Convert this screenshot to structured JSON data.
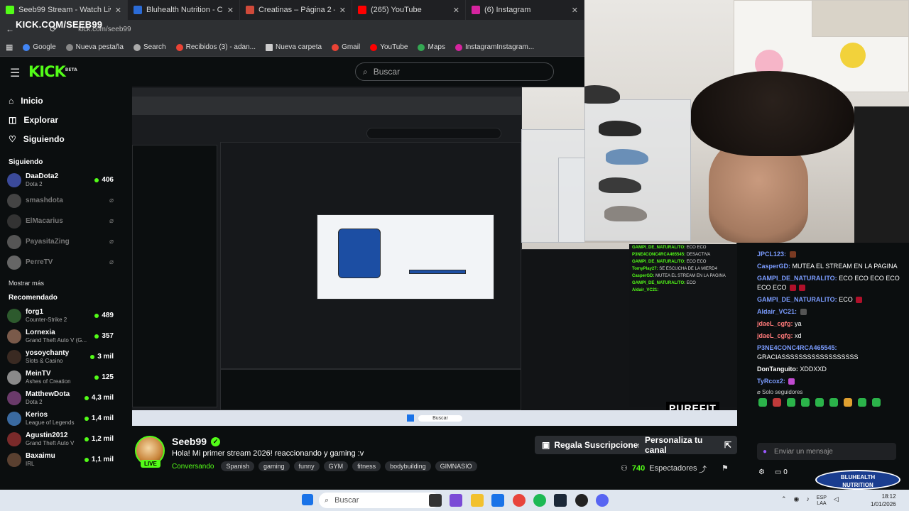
{
  "browser": {
    "tabs": [
      {
        "label": "Seeb99 Stream - Watch Live on",
        "color": "#53fc18",
        "active": true
      },
      {
        "label": "Bluhealth Nutrition - Calidad G",
        "color": "#2b6bd6",
        "active": false
      },
      {
        "label": "Creatinas – Página 2 – XL Nutri",
        "color": "#d04a3a",
        "active": false
      },
      {
        "label": "(265) YouTube",
        "color": "#ff0000",
        "active": false
      },
      {
        "label": "(6) Instagram",
        "color": "#d6249f",
        "active": false
      }
    ],
    "url": "kick.com/seeb99",
    "overlay_title": "KICK.COM/SEEB99",
    "bookmarks": [
      {
        "label": "Google",
        "color": "#4285f4"
      },
      {
        "label": "Nueva pestaña",
        "color": "#888888"
      },
      {
        "label": "Search",
        "color": "#aaaaaa"
      },
      {
        "label": "Recibidos (3) - adan...",
        "color": "#ea4335"
      },
      {
        "label": "Nueva carpeta",
        "color": "#cccccc"
      },
      {
        "label": "Gmail",
        "color": "#ea4335"
      },
      {
        "label": "YouTube",
        "color": "#ff0000"
      },
      {
        "label": "Maps",
        "color": "#34a853"
      },
      {
        "label": "InstagramInstagram...",
        "color": "#d6249f"
      }
    ]
  },
  "header": {
    "logo": "KICK",
    "logo_beta": "BETA",
    "search_placeholder": "Buscar"
  },
  "sidebar": {
    "nav": [
      {
        "label": "Inicio",
        "icon": "home-icon"
      },
      {
        "label": "Explorar",
        "icon": "compass-icon"
      },
      {
        "label": "Siguiendo",
        "icon": "heart-icon"
      }
    ],
    "following_title": "Siguiendo",
    "following": [
      {
        "name": "DaaDota2",
        "game": "Dota 2",
        "viewers": "406",
        "online": true
      },
      {
        "name": "smashdota",
        "game": "",
        "viewers": "",
        "online": false
      },
      {
        "name": "ElMacarius",
        "game": "",
        "viewers": "",
        "online": false
      },
      {
        "name": "PayasitaZing",
        "game": "",
        "viewers": "",
        "online": false
      },
      {
        "name": "PerreTV",
        "game": "",
        "viewers": "",
        "online": false
      }
    ],
    "show_more": "Mostrar más",
    "recommended_title": "Recomendado",
    "recommended": [
      {
        "name": "forg1",
        "game": "Counter-Strike 2",
        "viewers": "489"
      },
      {
        "name": "Lornexia",
        "game": "Grand Theft Auto V (G...",
        "viewers": "357"
      },
      {
        "name": "yosoychanty",
        "game": "Slots & Casino",
        "viewers": "3 mil"
      },
      {
        "name": "MeinTV",
        "game": "Ashes of Creation",
        "viewers": "125"
      },
      {
        "name": "MatthewDota",
        "game": "Dota 2",
        "viewers": "4,3 mil"
      },
      {
        "name": "Kerios",
        "game": "League of Legends",
        "viewers": "1,4 mil"
      },
      {
        "name": "Agustin2012",
        "game": "Grand Theft Auto V",
        "viewers": "1,2 mil"
      },
      {
        "name": "Baxaimu",
        "game": "IRL",
        "viewers": "1,1 mil"
      }
    ]
  },
  "stream": {
    "channel": "Seeb99",
    "live": "LIVE",
    "title": "Hola! Mi primer stream 2026! reaccionando y gaming :v",
    "category": "Conversando",
    "tags": [
      "Spanish",
      "gaming",
      "funny",
      "GYM",
      "fitness",
      "bodybuilding",
      "GIMNASIO"
    ],
    "subscribe_btn": "Regala Suscripciones",
    "customize_btn": "Personaliza tu canal",
    "viewers": "740",
    "viewers_label": "Espectadores"
  },
  "chat": {
    "messages": [
      {
        "user": "JPCL123:",
        "text": "",
        "color": "#7b9cff"
      },
      {
        "user": "CasperGD:",
        "text": "MUTEA EL STREAM EN LA PAGINA",
        "color": "#7b9cff"
      },
      {
        "user": "GAMPI_DE_NATURALITO:",
        "text": "ECO ECO ECO ECO ECO ECO",
        "color": "#7b9cff"
      },
      {
        "user": "GAMPI_DE_NATURALITO:",
        "text": "ECO",
        "color": "#7b9cff"
      },
      {
        "user": "Aldair_VC21:",
        "text": "",
        "color": "#7b9cff"
      },
      {
        "user": "jdaeL_cgfg:",
        "text": "ya",
        "color": "#ff7a7a"
      },
      {
        "user": "jdaeL_cgfg:",
        "text": "xd",
        "color": "#ff7a7a"
      },
      {
        "user": "P3NE4CONC4RCA465545:",
        "text": "GRACIASSSSSSSSSSSSSSSSSS",
        "color": "#7b9cff"
      },
      {
        "user": "DonTanguito:",
        "text": "XDDXXD",
        "color": "#ffffff"
      },
      {
        "user": "TyRcox2:",
        "text": "",
        "color": "#7b9cff"
      }
    ],
    "followers_only": "Solo seguidores",
    "input_placeholder": "Enviar un mensaje",
    "points": "0"
  },
  "sponsor": {
    "line1": "BLUHEALTH",
    "line2": "NUTRITION",
    "purefit": "PUREFIT"
  },
  "windows": {
    "search": "Buscar",
    "lang": "ESP",
    "lang2": "LAA",
    "time": "18:12",
    "date": "1/01/2026"
  }
}
